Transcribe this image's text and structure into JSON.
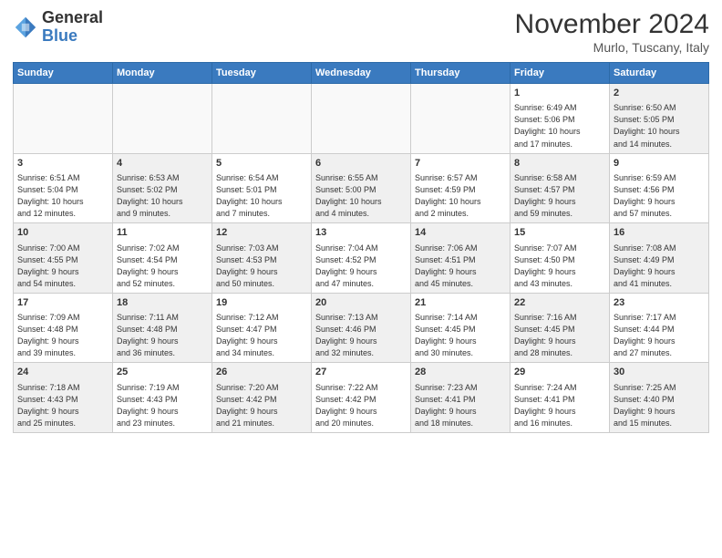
{
  "header": {
    "logo_line1": "General",
    "logo_line2": "Blue",
    "month_title": "November 2024",
    "location": "Murlo, Tuscany, Italy"
  },
  "weekdays": [
    "Sunday",
    "Monday",
    "Tuesday",
    "Wednesday",
    "Thursday",
    "Friday",
    "Saturday"
  ],
  "weeks": [
    [
      {
        "day": "",
        "info": ""
      },
      {
        "day": "",
        "info": ""
      },
      {
        "day": "",
        "info": ""
      },
      {
        "day": "",
        "info": ""
      },
      {
        "day": "",
        "info": ""
      },
      {
        "day": "1",
        "info": "Sunrise: 6:49 AM\nSunset: 5:06 PM\nDaylight: 10 hours\nand 17 minutes."
      },
      {
        "day": "2",
        "info": "Sunrise: 6:50 AM\nSunset: 5:05 PM\nDaylight: 10 hours\nand 14 minutes."
      }
    ],
    [
      {
        "day": "3",
        "info": "Sunrise: 6:51 AM\nSunset: 5:04 PM\nDaylight: 10 hours\nand 12 minutes."
      },
      {
        "day": "4",
        "info": "Sunrise: 6:53 AM\nSunset: 5:02 PM\nDaylight: 10 hours\nand 9 minutes."
      },
      {
        "day": "5",
        "info": "Sunrise: 6:54 AM\nSunset: 5:01 PM\nDaylight: 10 hours\nand 7 minutes."
      },
      {
        "day": "6",
        "info": "Sunrise: 6:55 AM\nSunset: 5:00 PM\nDaylight: 10 hours\nand 4 minutes."
      },
      {
        "day": "7",
        "info": "Sunrise: 6:57 AM\nSunset: 4:59 PM\nDaylight: 10 hours\nand 2 minutes."
      },
      {
        "day": "8",
        "info": "Sunrise: 6:58 AM\nSunset: 4:57 PM\nDaylight: 9 hours\nand 59 minutes."
      },
      {
        "day": "9",
        "info": "Sunrise: 6:59 AM\nSunset: 4:56 PM\nDaylight: 9 hours\nand 57 minutes."
      }
    ],
    [
      {
        "day": "10",
        "info": "Sunrise: 7:00 AM\nSunset: 4:55 PM\nDaylight: 9 hours\nand 54 minutes."
      },
      {
        "day": "11",
        "info": "Sunrise: 7:02 AM\nSunset: 4:54 PM\nDaylight: 9 hours\nand 52 minutes."
      },
      {
        "day": "12",
        "info": "Sunrise: 7:03 AM\nSunset: 4:53 PM\nDaylight: 9 hours\nand 50 minutes."
      },
      {
        "day": "13",
        "info": "Sunrise: 7:04 AM\nSunset: 4:52 PM\nDaylight: 9 hours\nand 47 minutes."
      },
      {
        "day": "14",
        "info": "Sunrise: 7:06 AM\nSunset: 4:51 PM\nDaylight: 9 hours\nand 45 minutes."
      },
      {
        "day": "15",
        "info": "Sunrise: 7:07 AM\nSunset: 4:50 PM\nDaylight: 9 hours\nand 43 minutes."
      },
      {
        "day": "16",
        "info": "Sunrise: 7:08 AM\nSunset: 4:49 PM\nDaylight: 9 hours\nand 41 minutes."
      }
    ],
    [
      {
        "day": "17",
        "info": "Sunrise: 7:09 AM\nSunset: 4:48 PM\nDaylight: 9 hours\nand 39 minutes."
      },
      {
        "day": "18",
        "info": "Sunrise: 7:11 AM\nSunset: 4:48 PM\nDaylight: 9 hours\nand 36 minutes."
      },
      {
        "day": "19",
        "info": "Sunrise: 7:12 AM\nSunset: 4:47 PM\nDaylight: 9 hours\nand 34 minutes."
      },
      {
        "day": "20",
        "info": "Sunrise: 7:13 AM\nSunset: 4:46 PM\nDaylight: 9 hours\nand 32 minutes."
      },
      {
        "day": "21",
        "info": "Sunrise: 7:14 AM\nSunset: 4:45 PM\nDaylight: 9 hours\nand 30 minutes."
      },
      {
        "day": "22",
        "info": "Sunrise: 7:16 AM\nSunset: 4:45 PM\nDaylight: 9 hours\nand 28 minutes."
      },
      {
        "day": "23",
        "info": "Sunrise: 7:17 AM\nSunset: 4:44 PM\nDaylight: 9 hours\nand 27 minutes."
      }
    ],
    [
      {
        "day": "24",
        "info": "Sunrise: 7:18 AM\nSunset: 4:43 PM\nDaylight: 9 hours\nand 25 minutes."
      },
      {
        "day": "25",
        "info": "Sunrise: 7:19 AM\nSunset: 4:43 PM\nDaylight: 9 hours\nand 23 minutes."
      },
      {
        "day": "26",
        "info": "Sunrise: 7:20 AM\nSunset: 4:42 PM\nDaylight: 9 hours\nand 21 minutes."
      },
      {
        "day": "27",
        "info": "Sunrise: 7:22 AM\nSunset: 4:42 PM\nDaylight: 9 hours\nand 20 minutes."
      },
      {
        "day": "28",
        "info": "Sunrise: 7:23 AM\nSunset: 4:41 PM\nDaylight: 9 hours\nand 18 minutes."
      },
      {
        "day": "29",
        "info": "Sunrise: 7:24 AM\nSunset: 4:41 PM\nDaylight: 9 hours\nand 16 minutes."
      },
      {
        "day": "30",
        "info": "Sunrise: 7:25 AM\nSunset: 4:40 PM\nDaylight: 9 hours\nand 15 minutes."
      }
    ]
  ]
}
